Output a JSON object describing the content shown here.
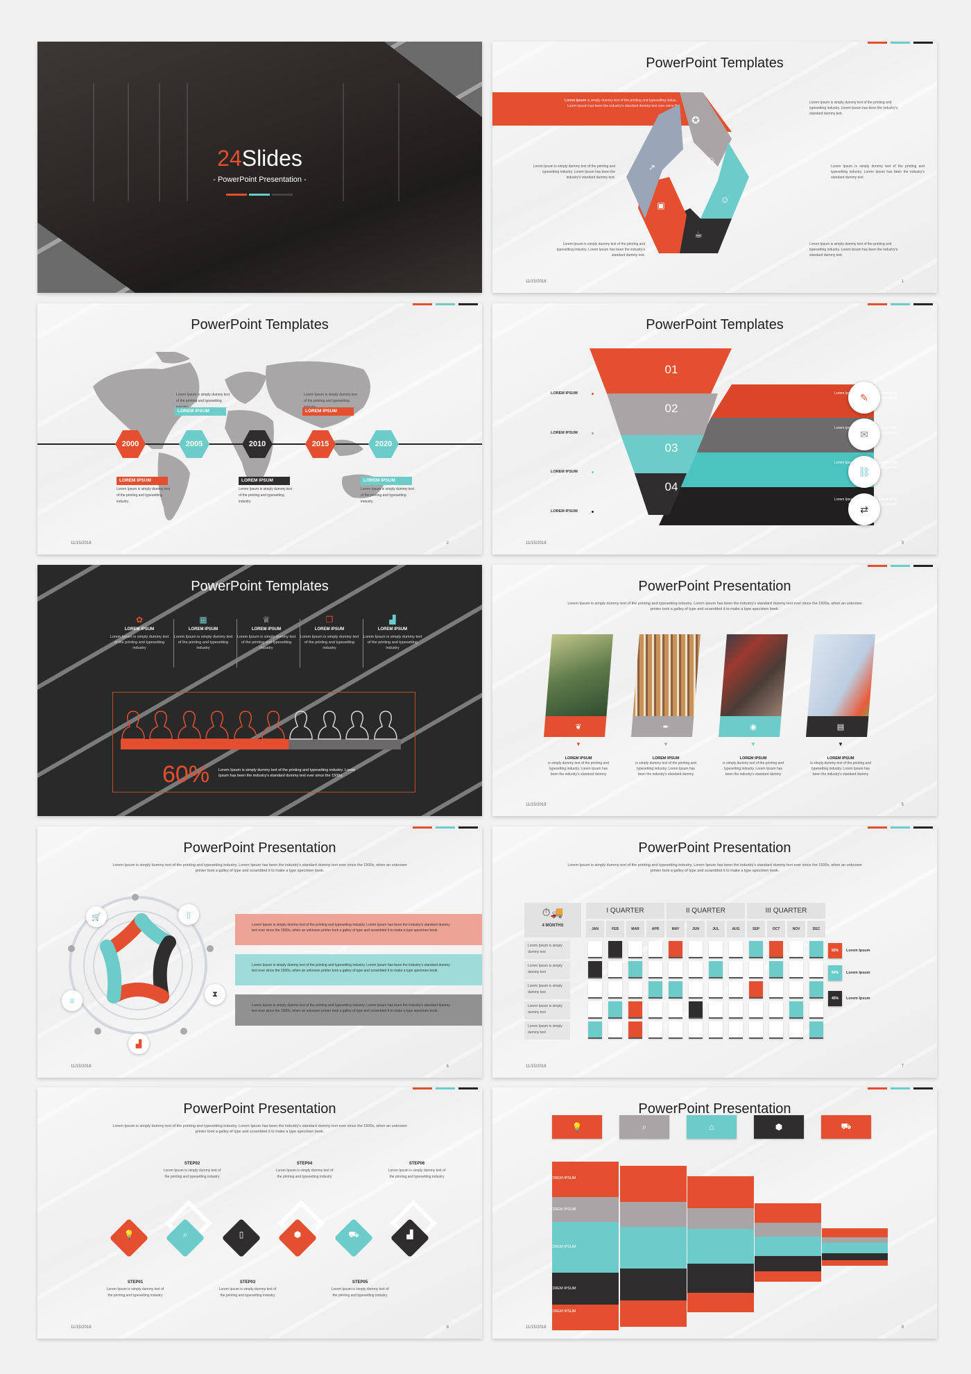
{
  "colors": {
    "orange": "#e4502f",
    "teal": "#6cccc9",
    "dark": "#2f2d2e",
    "gray": "#a9a5a6",
    "blue_gray": "#9aa6b8"
  },
  "common": {
    "date": "11/15/2018"
  },
  "slide1": {
    "logo_num": "24",
    "logo_text": "Slides",
    "subtitle": "- PowerPoint Presentation -"
  },
  "slide2": {
    "title": "PowerPoint Templates",
    "banner_bold": "Lorem Ipsum",
    "banner_text": " is simply dummy text of the printing and typesetting industry. Lorem Ipsum has been the industry's standard dummy text ever since the 1500s.",
    "texts": [
      "Lorem Ipsum is simply dummy text of the printing and typesetting industry. Lorem Ipsum has been the industry's standard dummy text.",
      "Lorem Ipsum is simply dummy text of the printing and typesetting industry. Lorem Ipsum has been the industry's standard dummy text.",
      "Lorem Ipsum is simply dummy text of the printing and typesetting industry. Lorem Ipsum has been the industry's standard dummy text.",
      "Lorem Ipsum is simply dummy text of the printing and typesetting industry. Lorem Ipsum has been the industry's standard dummy text.",
      "Lorem Ipsum is simply dummy text of the printing and typesetting industry. Lorem Ipsum has been the industry's standard dummy text."
    ],
    "page": "1"
  },
  "slide3": {
    "title": "PowerPoint Templates",
    "years": [
      "2000",
      "2005",
      "2010",
      "2015",
      "2020"
    ],
    "label": "LOREM IPSUM",
    "desc": "Lorem Ipsum is simply dummy text of the printing and typesetting industry",
    "page": "2"
  },
  "slide4": {
    "title": "PowerPoint Templates",
    "levels": [
      {
        "num": "01",
        "label": "LOREM IPSUM",
        "text": "Lorem Ipsum is simply dummy text of the printing and typesetting industry"
      },
      {
        "num": "02",
        "label": "LOREM IPSUM",
        "text": "Lorem Ipsum is simply dummy text of the printing and typesetting industry"
      },
      {
        "num": "03",
        "label": "LOREM IPSUM",
        "text": "Lorem Ipsum is simply dummy text of the printing and typesetting industry"
      },
      {
        "num": "04",
        "label": "LOREM IPSUM",
        "text": "Lorem Ipsum is simply dummy text of the printing and typesetting industry"
      }
    ],
    "page": "3"
  },
  "slide5": {
    "title": "PowerPoint Templates",
    "columns": [
      {
        "heading": "LOREM IPSUM",
        "text": "Lorem Ipsum is simply dummy text of the printing and typesetting industry"
      },
      {
        "heading": "LOREM IPSUM",
        "text": "Lorem Ipsum is simply dummy text of the printing and typesetting industry"
      },
      {
        "heading": "LOREM IPSUM",
        "text": "Lorem Ipsum is simply dummy text of the printing and typesetting industry"
      },
      {
        "heading": "LOREM IPSUM",
        "text": "Lorem Ipsum is simply dummy text of the printing and typesetting industry"
      },
      {
        "heading": "LOREM IPSUM",
        "text": "Lorem Ipsum is simply dummy text of the printing and typesetting industry"
      }
    ],
    "people_total": 10,
    "people_highlighted": 6,
    "progress_percent": 60,
    "percent_label": "60%",
    "percent_text": "Lorem Ipsum is simply dummy text of the printing and typesetting industry. Lorem Ipsum has been the industry's standard dummy text ever since the 1500s."
  },
  "slide6": {
    "title": "PowerPoint Presentation",
    "subtitle": "Lorem Ipsum is simply dummy text of the printing and typesetting industry. Lorem Ipsum has been the industry's standard dummy text ever since the 1500s, when an unknown printer took a galley of type and scrambled it to make a type specimen book.",
    "cards": [
      {
        "heading": "LOREM IPSUM",
        "text": "is simply dummy text of the printing and typesetting industry. Lorem Ipsum has been the industry's standard dummy"
      },
      {
        "heading": "LOREM IPSUM",
        "text": "is simply dummy text of the printing and typesetting industry. Lorem Ipsum has been the industry's standard dummy"
      },
      {
        "heading": "LOREM IPSUM",
        "text": "is simply dummy text of the printing and typesetting industry. Lorem Ipsum has been the industry's standard dummy"
      },
      {
        "heading": "LOREM IPSUM",
        "text": "is simply dummy text of the printing and typesetting industry. Lorem Ipsum has been the industry's standard dummy"
      }
    ],
    "page": "5"
  },
  "slide7": {
    "title": "PowerPoint Presentation",
    "subtitle": "Lorem Ipsum is simply dummy text of the printing and typesetting industry. Lorem Ipsum has been the industry's standard dummy text ever since the 1500s, when an unknown printer took a galley of type and scrambled it to make a type specimen book.",
    "boxes": [
      "Lorem Ipsum is simply dummy text of the printing and typesetting industry. Lorem Ipsum has been the industry's standard dummy text ever since the 1500s, when an unknown printer took a galley of type and scrambled it to make a type specimen book.",
      "Lorem Ipsum is simply dummy text of the printing and typesetting industry. Lorem Ipsum has been the industry's standard dummy text ever since the 1500s, when an unknown printer took a galley of type and scrambled it to make a type specimen book.",
      "Lorem Ipsum is simply dummy text of the printing and typesetting industry. Lorem Ipsum has been the industry's standard dummy text ever since the 1500s, when an unknown printer took a galley of type and scrambled it to make a type specimen book."
    ],
    "page": "6"
  },
  "slide8": {
    "title": "PowerPoint Presentation",
    "subtitle": "Lorem Ipsum is simply dummy text of the printing and typesetting industry. Lorem Ipsum has been the industry's standard dummy text ever since the 1500s, when an unknown printer took a galley of type and scrambled it to make a type specimen book.",
    "corner_label": "4 MONTHS",
    "quarters": [
      "I QUARTER",
      "II QUARTER",
      "III QUARTER"
    ],
    "months": [
      "JAN",
      "FEB",
      "MAR",
      "APR",
      "MAY",
      "JUN",
      "JUL",
      "AUG",
      "SEP",
      "OCT",
      "NOV",
      "DEC"
    ],
    "row_label": "Lorem Ipsum is simply dummy text",
    "grid": [
      [
        "",
        "d",
        "",
        "",
        "o",
        "",
        "",
        "",
        "t",
        "o",
        "",
        "t"
      ],
      [
        "d",
        "",
        "t",
        "",
        "",
        "",
        "t",
        "",
        "",
        "t",
        "",
        ""
      ],
      [
        "",
        "",
        "",
        "t",
        "t",
        "",
        "",
        "",
        "o",
        "",
        "",
        "t"
      ],
      [
        "",
        "t",
        "o",
        "",
        "",
        "d",
        "",
        "",
        "",
        "",
        "t",
        ""
      ],
      [
        "t",
        "",
        "o",
        "",
        "",
        "",
        "",
        "",
        "",
        "",
        "",
        "t"
      ]
    ],
    "legend": [
      {
        "value": "55%",
        "label": "Lorem Ipsum",
        "color": "o"
      },
      {
        "value": "60%",
        "label": "Lorem Ipsum",
        "color": "t"
      },
      {
        "value": "45%",
        "label": "Lorem Ipsum",
        "color": "d"
      }
    ],
    "page": "7"
  },
  "slide9": {
    "title": "PowerPoint Presentation",
    "subtitle": "Lorem Ipsum is simply dummy text of the printing and typesetting industry. Lorem Ipsum has been the industry's standard dummy text ever since the 1500s, when an unknown printer took a galley of type and scrambled it to make a type specimen book.",
    "steps": [
      {
        "label": "STEP01",
        "text": "Lorem Ipsum is simply dummy text of the printing and typesetting industry"
      },
      {
        "label": "STEP02",
        "text": "Lorem Ipsum is simply dummy text of the printing and typesetting industry"
      },
      {
        "label": "STEP03",
        "text": "Lorem Ipsum is simply dummy text of the printing and typesetting industry"
      },
      {
        "label": "STEP04",
        "text": "Lorem Ipsum is simply dummy text of the printing and typesetting industry"
      },
      {
        "label": "STEP05",
        "text": "Lorem Ipsum is simply dummy text of the printing and typesetting industry"
      },
      {
        "label": "STEP06",
        "text": "Lorem Ipsum is simply dummy text of the printing and typesetting industry"
      }
    ],
    "page": "8"
  },
  "slide10": {
    "title": "PowerPoint Presentation",
    "labels": [
      "LOREM IPSUM",
      "LOREM IPSUM",
      "LOREM IPSUM",
      "LOREM IPSUM",
      "LOREM IPSUM"
    ],
    "page": "9"
  }
}
